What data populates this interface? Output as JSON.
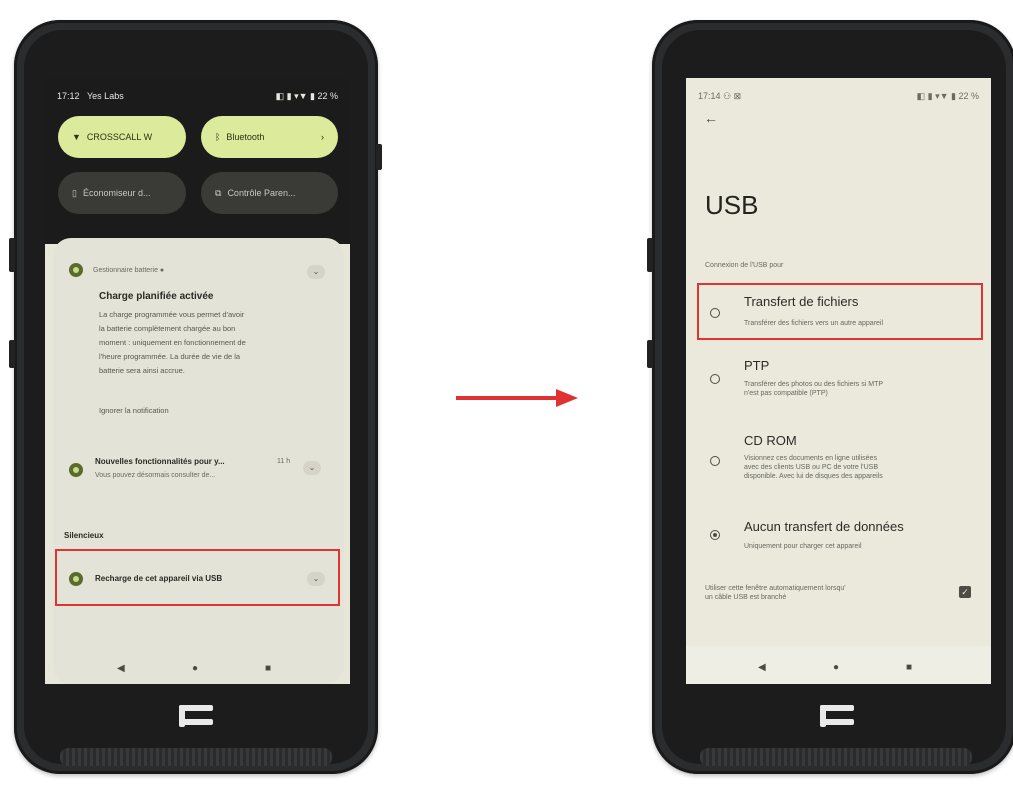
{
  "left_phone": {
    "status_bar": {
      "time": "17:12",
      "carrier": "Yes Labs",
      "icons": "◧ ▮ ▾▼ ▮ 22 %"
    },
    "quick_tiles": [
      {
        "icon": "wifi-icon",
        "label": "CROSSCALL W"
      },
      {
        "icon": "bluetooth-icon",
        "label": "Bluetooth",
        "arrow": "›"
      },
      {
        "icon": "battery-saver-icon",
        "label": "Économiseur d..."
      },
      {
        "icon": "cast-icon",
        "label": "Contrôle Paren..."
      }
    ],
    "notification_1": {
      "app": "Gestionnaire batterie ●",
      "title": "Charge planifiée activée",
      "body_lines": [
        "La charge programmée vous permet d'avoir",
        "la batterie complètement chargée au bon",
        "moment : uniquement en fonctionnement de",
        "l'heure programmée. La durée de vie de la",
        "batterie sera ainsi accrue."
      ],
      "action": "Ignorer la notification"
    },
    "notification_2": {
      "title": "Nouvelles fonctionnalités pour y...",
      "time": "11 h",
      "body": "Vous pouvez désormais consulter de..."
    },
    "section_label": "Silencieux",
    "usb_notification": {
      "title": "Recharge de cet appareil via USB"
    },
    "nav": {
      "back": "◀",
      "home": "●",
      "recents": "■"
    }
  },
  "arrow": {
    "color": "#e03232"
  },
  "right_phone": {
    "status_bar": {
      "time": "17:14 ⚇ ⊠",
      "icons": "◧ ▮ ▾▼ ▮ 22 %"
    },
    "back_arrow": "←",
    "page_title": "USB",
    "section_label": "Connexion de l'USB pour",
    "options": [
      {
        "title": "Transfert de fichiers",
        "desc": [
          "Transférer des fichiers vers un autre appareil"
        ],
        "selected": false
      },
      {
        "title": "PTP",
        "desc": [
          "Transférer des photos ou des fichiers si MTP",
          "n'est pas compatible (PTP)"
        ],
        "selected": false
      },
      {
        "title": "CD ROM",
        "desc": [
          "Visionnez ces documents en ligne utilisées",
          "avec des clients USB ou PC de votre l'USB",
          "disponible. Avec lui de disques des appareils"
        ],
        "selected": false
      },
      {
        "title": "Aucun transfert de données",
        "desc": [
          "Uniquement pour charger cet appareil"
        ],
        "selected": true
      }
    ],
    "footer_setting": {
      "lines": [
        "Utiliser cette fenêtre automatiquement lorsqu'",
        "un câble USB est branché"
      ],
      "checked": true
    },
    "nav": {
      "back": "◀",
      "home": "●",
      "recents": "■"
    }
  },
  "highlight_color": "#e03434",
  "accent_color": "#dcea9c"
}
